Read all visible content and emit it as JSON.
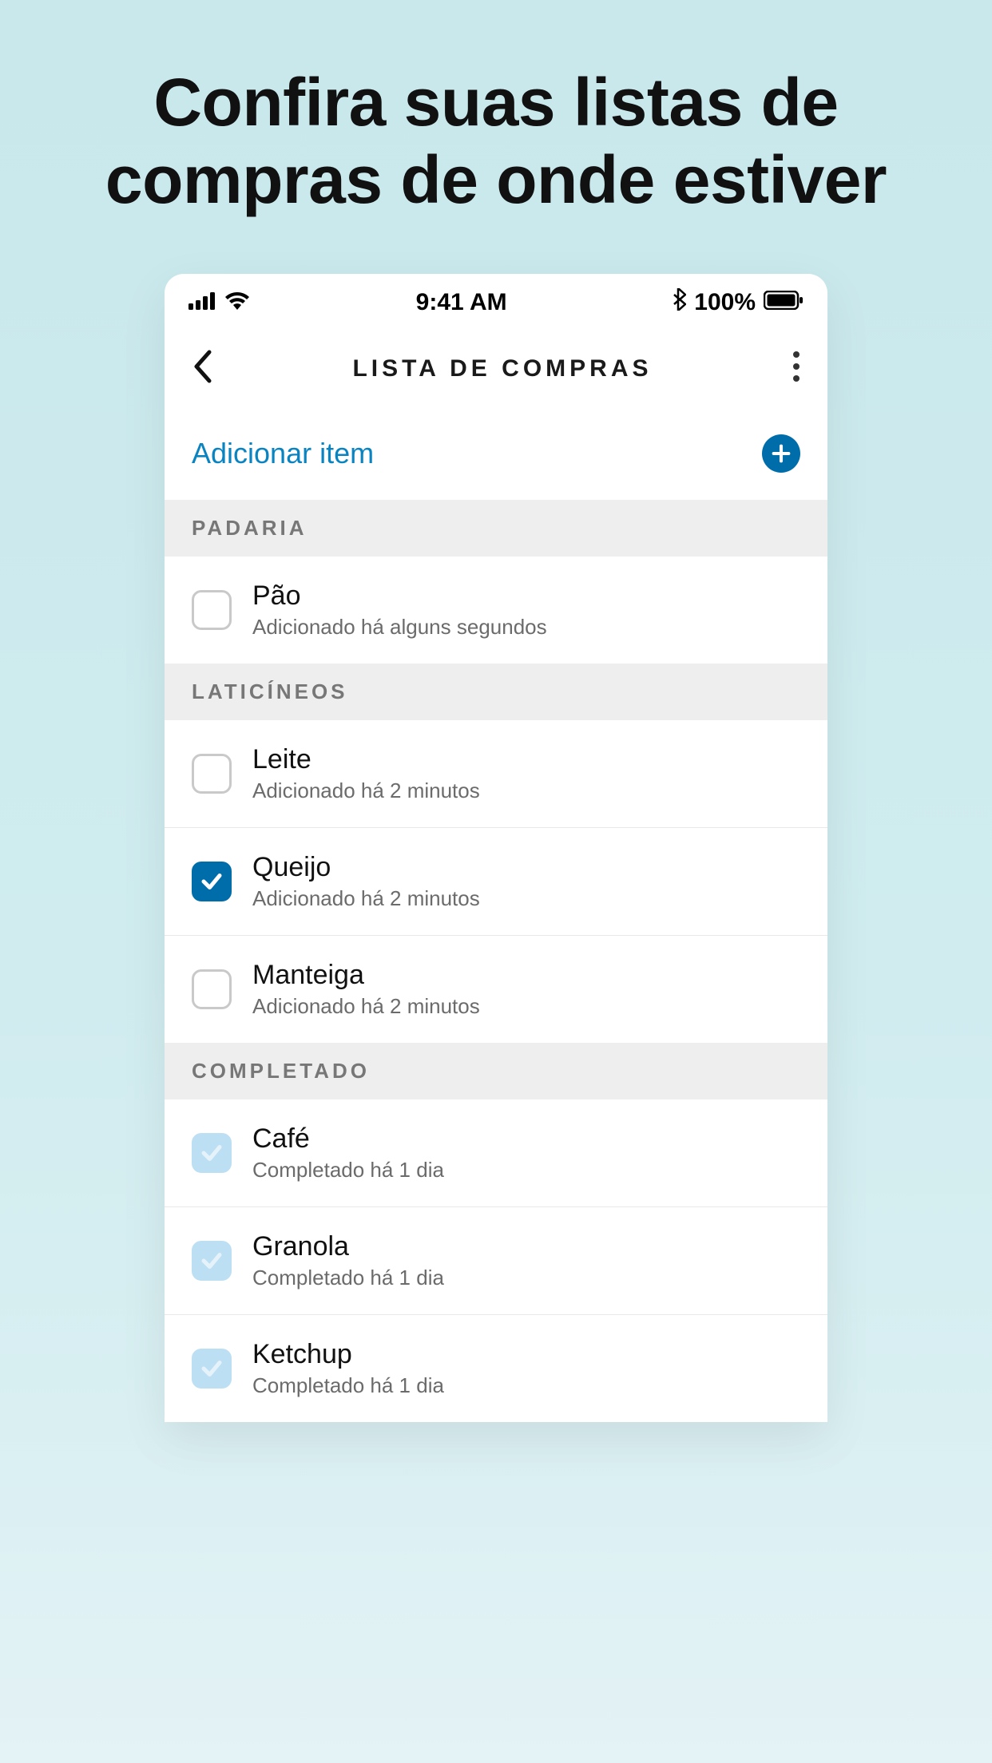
{
  "headline": "Confira suas listas de compras de onde estiver",
  "status": {
    "time": "9:41 AM",
    "battery": "100%"
  },
  "nav": {
    "title": "LISTA DE COMPRAS"
  },
  "add": {
    "label": "Adicionar item"
  },
  "sections": [
    {
      "header": "PADARIA",
      "items": [
        {
          "title": "Pão",
          "sub": "Adicionado há alguns segundos",
          "state": "unchecked"
        }
      ]
    },
    {
      "header": "LATICÍNEOS",
      "items": [
        {
          "title": "Leite",
          "sub": "Adicionado há 2 minutos",
          "state": "unchecked"
        },
        {
          "title": "Queijo",
          "sub": "Adicionado há 2 minutos",
          "state": "checked"
        },
        {
          "title": "Manteiga",
          "sub": "Adicionado há 2 minutos",
          "state": "unchecked"
        }
      ]
    },
    {
      "header": "COMPLETADO",
      "items": [
        {
          "title": "Café",
          "sub": "Completado há 1 dia",
          "state": "completed"
        },
        {
          "title": "Granola",
          "sub": "Completado há 1 dia",
          "state": "completed"
        },
        {
          "title": "Ketchup",
          "sub": "Completado há 1 dia",
          "state": "completed"
        }
      ]
    }
  ]
}
